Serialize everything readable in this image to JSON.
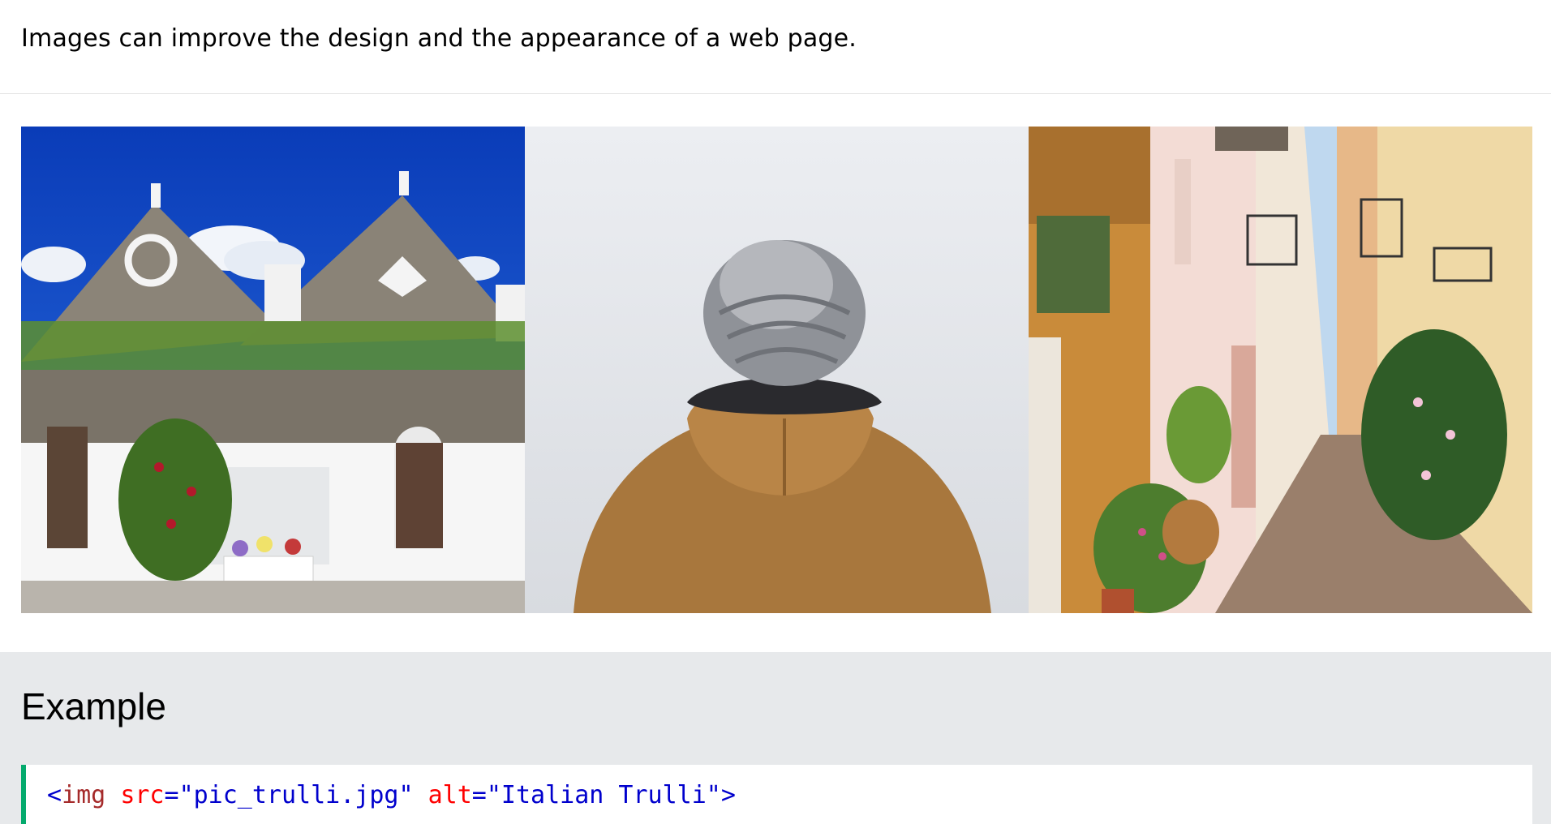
{
  "intro_text": "Images can improve the design and the appearance of a web page.",
  "images": [
    {
      "name": "trulli-photo",
      "alt": "Italian Trulli"
    },
    {
      "name": "girl-in-jacket-photo",
      "alt": "Girl in a jacket"
    },
    {
      "name": "street-photo",
      "alt": "Street view"
    }
  ],
  "example": {
    "title": "Example",
    "code": {
      "open_bracket": "<",
      "tag": "img",
      "attr1": "src",
      "eq1": "=",
      "val1": "\"pic_trulli.jpg\"",
      "attr2": "alt",
      "eq2": "=",
      "val2": "\"Italian Trulli\"",
      "close_bracket": ">"
    }
  },
  "colors": {
    "accent_green": "#04aa6d",
    "panel_bg": "#e7e9eb",
    "code_tag": "#a52a2a",
    "code_attr": "#ff0000",
    "code_value": "#0000cd"
  }
}
